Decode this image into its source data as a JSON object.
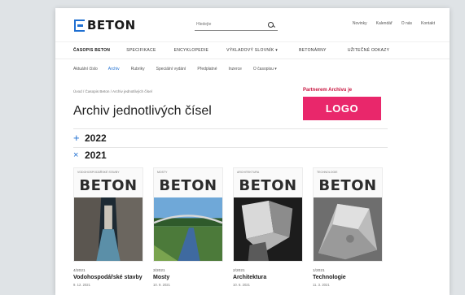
{
  "header": {
    "brand": "BETON",
    "search_placeholder": "Hledejte",
    "links": [
      "Novinky",
      "Kalendář",
      "O nás",
      "Kontakt"
    ]
  },
  "main_nav": [
    {
      "label": "Časopis Beton",
      "active": true
    },
    {
      "label": "Specifikace",
      "active": false
    },
    {
      "label": "Encyklopedie",
      "active": false
    },
    {
      "label": "Výkladový slovník ▾",
      "active": false
    },
    {
      "label": "Betonárny",
      "active": false
    },
    {
      "label": "Užitečné odkazy",
      "active": false
    }
  ],
  "sub_nav": [
    {
      "label": "Aktuální číslo",
      "active": false
    },
    {
      "label": "Archiv",
      "active": true
    },
    {
      "label": "Rubriky",
      "active": false
    },
    {
      "label": "Speciální vydání",
      "active": false
    },
    {
      "label": "Předplatné",
      "active": false
    },
    {
      "label": "Inzerce",
      "active": false
    },
    {
      "label": "O časopisu ▾",
      "active": false
    }
  ],
  "breadcrumb": "Úvod / Časopis Beton / Archiv jednotlivých čísel",
  "page_title": "Archiv jednotlivých čísel",
  "partner": {
    "label": "Partnerem Archivu je",
    "logo": "LOGO"
  },
  "years": [
    {
      "toggle": "+",
      "year": "2022"
    },
    {
      "toggle": "×",
      "year": "2021"
    }
  ],
  "issues": [
    {
      "number": "4/2021",
      "title": "Vodohospodářské stavby",
      "date": "9. 12. 2021",
      "mast": "BETON",
      "kicker": "VODOHOSPODÁŘSKÉ STAVBY"
    },
    {
      "number": "3/2021",
      "title": "Mosty",
      "date": "10. 9. 2021",
      "mast": "BETON",
      "kicker": "MOSTY"
    },
    {
      "number": "2/2021",
      "title": "Architektura",
      "date": "10. 6. 2021",
      "mast": "BETON",
      "kicker": "ARCHITEKTURA"
    },
    {
      "number": "1/2021",
      "title": "Technologie",
      "date": "11. 3. 2021",
      "mast": "BETON",
      "kicker": "TECHNOLOGIE"
    }
  ],
  "colors": {
    "accent": "#1f6fd1",
    "partner_logo_bg": "#e9276b",
    "partner_label": "#c8143f"
  }
}
